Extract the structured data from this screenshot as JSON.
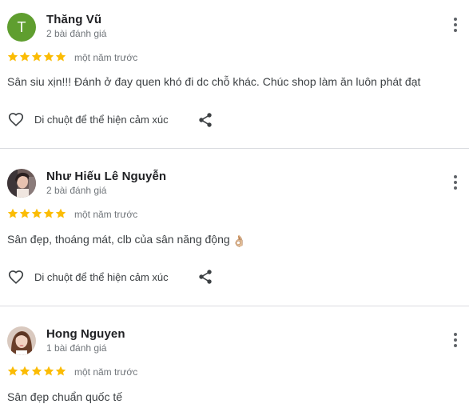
{
  "colors": {
    "star": "#fbbc04",
    "avatar_letter_bg": "#5f9e2f",
    "secondary_text": "#70757a",
    "divider": "#dadce0"
  },
  "reviews": [
    {
      "avatar_letter": "T",
      "name": "Thăng Vũ",
      "count": "2 bài đánh giá",
      "rating": 5,
      "time": "một năm trước",
      "text": "Sân siu xịn!!! Đánh ở đay quen khó đi dc chỗ khác. Chúc shop làm ăn luôn phát đạt",
      "like_label": "Di chuột để thể hiện cảm xúc"
    },
    {
      "avatar_letter": "",
      "name": "Như Hiếu Lê Nguyễn",
      "count": "2 bài đánh giá",
      "rating": 5,
      "time": "một năm trước",
      "text": "Sân đẹp, thoáng mát, clb của sân năng động",
      "emoji": "👌🏼",
      "like_label": "Di chuột để thể hiện cảm xúc"
    },
    {
      "avatar_letter": "",
      "name": "Hong Nguyen",
      "count": "1 bài đánh giá",
      "rating": 5,
      "time": "một năm trước",
      "text": "Sân đẹp chuẩn quốc tế"
    }
  ]
}
